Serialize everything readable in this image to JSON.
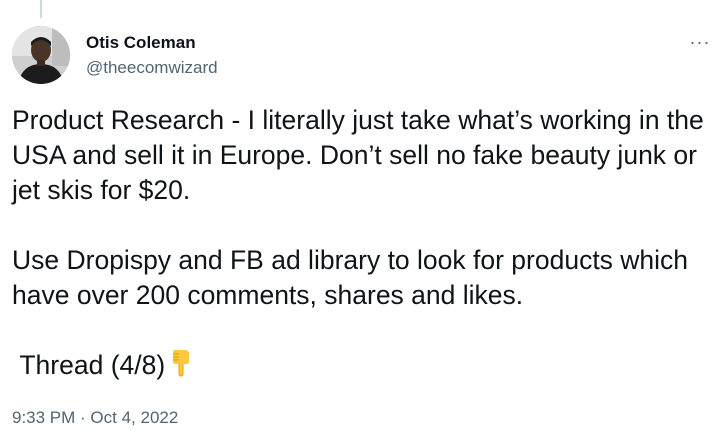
{
  "author": {
    "display_name": "Otis Coleman",
    "handle": "@theecomwizard"
  },
  "menu": {
    "more_label": "···"
  },
  "tweet": {
    "paragraph_1": "Product Research - I literally just take what’s working in the USA and sell it in Europe. Don’t sell no fake beauty junk or jet skis for $20.",
    "paragraph_2": "Use Dropispy and FB ad library to look for products which have over 200 comments, shares and likes.",
    "paragraph_3": " Thread (4/8)",
    "emoji_icon": "backhand-index-pointing-down-emoji"
  },
  "meta": {
    "timestamp": "9:33 PM · Oct 4, 2022"
  },
  "colors": {
    "text": "#0f1419",
    "secondary": "#536471",
    "thread_line": "#cfd9de"
  }
}
